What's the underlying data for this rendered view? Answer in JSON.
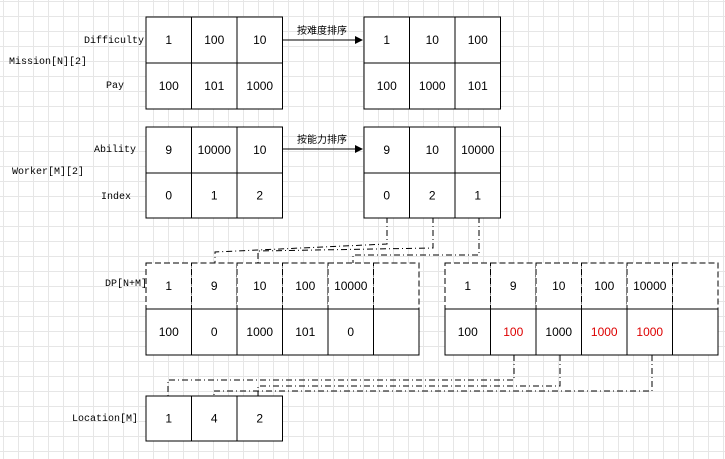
{
  "labels": {
    "mission": "Mission[N][2]",
    "difficulty": "Difficulty",
    "pay": "Pay",
    "worker": "Worker[M][2]",
    "ability": "Ability",
    "index": "Index",
    "dp": "DP[N+M]",
    "location": "Location[M]"
  },
  "arrows": {
    "sort_by_difficulty": "按难度排序",
    "sort_by_ability": "按能力排序"
  },
  "mission_original": [
    [
      "1",
      "100",
      "10"
    ],
    [
      "100",
      "101",
      "1000"
    ]
  ],
  "mission_sorted": [
    [
      "1",
      "10",
      "100"
    ],
    [
      "100",
      "1000",
      "101"
    ]
  ],
  "worker_original": [
    [
      "9",
      "10000",
      "10"
    ],
    [
      "0",
      "1",
      "2"
    ]
  ],
  "worker_sorted": [
    [
      "9",
      "10",
      "10000"
    ],
    [
      "0",
      "2",
      "1"
    ]
  ],
  "dp_left": [
    [
      "1",
      "9",
      "10",
      "100",
      "10000",
      ""
    ],
    [
      "100",
      "0",
      "1000",
      "101",
      "0",
      ""
    ]
  ],
  "dp_right": [
    [
      "1",
      "9",
      "10",
      "100",
      "10000",
      ""
    ],
    [
      "100",
      "100",
      "1000",
      "1000",
      "1000",
      ""
    ]
  ],
  "dp_right_highlighted": [
    [
      1,
      1
    ],
    [
      1,
      3
    ],
    [
      1,
      4
    ]
  ],
  "location": [
    "1",
    "4",
    "2"
  ],
  "highlight_color": "#dd0000"
}
